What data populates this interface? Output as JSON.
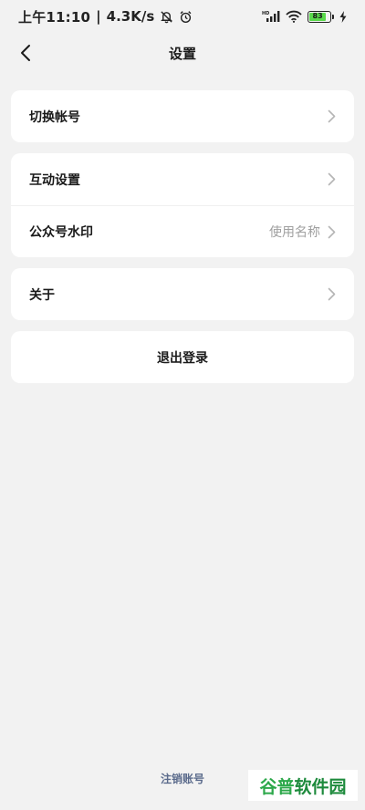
{
  "status_bar": {
    "time": "上午11:10",
    "separator": "|",
    "net_speed": "4.3K/s",
    "battery_level": "83",
    "icons": [
      "mute-bell-icon",
      "alarm-icon",
      "hd-signal-icon",
      "wifi-icon",
      "battery-icon",
      "charging-icon"
    ]
  },
  "header": {
    "title": "设置",
    "back_icon": "chevron-left-icon"
  },
  "groups": [
    {
      "items": [
        {
          "label": "切换帐号",
          "value": ""
        }
      ]
    },
    {
      "items": [
        {
          "label": "互动设置",
          "value": ""
        },
        {
          "label": "公众号水印",
          "value": "使用名称"
        }
      ]
    },
    {
      "items": [
        {
          "label": "关于",
          "value": ""
        }
      ]
    }
  ],
  "logout": {
    "label": "退出登录"
  },
  "footer": {
    "cancel_account": "注销账号",
    "watermark_a": "谷普",
    "watermark_b": "软件园"
  },
  "colors": {
    "background": "#f2f2f2",
    "card": "#ffffff",
    "link": "#5b6b8c",
    "battery": "#5ad94c",
    "watermark": "#2ca84a"
  }
}
